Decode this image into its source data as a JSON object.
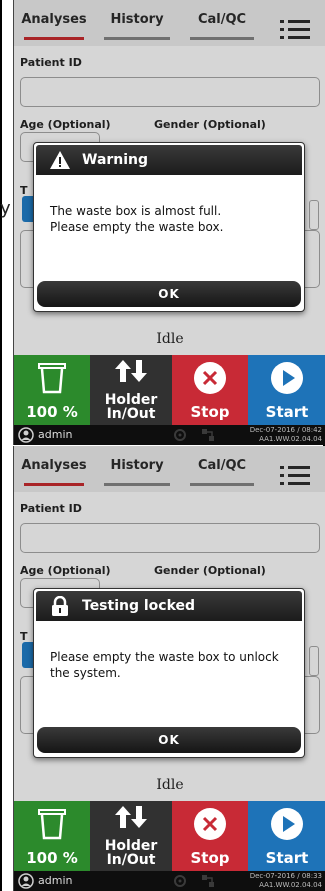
{
  "side_glyph": "y",
  "screens": [
    {
      "tabs": [
        {
          "label": "Analyses",
          "active": true
        },
        {
          "label": "History",
          "active": false
        },
        {
          "label": "Cal/QC",
          "active": false
        }
      ],
      "menu_icon": "hamburger-menu-icon",
      "form": {
        "patient_id_label": "Patient ID",
        "age_label": "Age (Optional)",
        "gender_label": "Gender (Optional)",
        "partial_label": "T"
      },
      "dialog": {
        "icon": "warning-triangle-icon",
        "title": "Warning",
        "lines": [
          "The waste box is almost full.",
          "Please empty the waste box."
        ],
        "ok_label": "OK"
      },
      "status_text": "Idle",
      "actions": {
        "waste_percent": "100 %",
        "holder_line1": "Holder",
        "holder_line2": "In/Out",
        "stop": "Stop",
        "start": "Start"
      },
      "statusbar": {
        "user": "admin",
        "datetime": "Dec-07-2016 / 08:42",
        "version": "AA1.WW.02.04.04"
      }
    },
    {
      "tabs": [
        {
          "label": "Analyses",
          "active": true
        },
        {
          "label": "History",
          "active": false
        },
        {
          "label": "Cal/QC",
          "active": false
        }
      ],
      "menu_icon": "hamburger-menu-icon",
      "form": {
        "patient_id_label": "Patient ID",
        "age_label": "Age (Optional)",
        "gender_label": "Gender (Optional)",
        "partial_label": "T"
      },
      "dialog": {
        "icon": "lock-icon",
        "title": "Testing locked",
        "lines": [
          "Please empty the waste box to unlock",
          "the system."
        ],
        "ok_label": "OK"
      },
      "status_text": "Idle",
      "actions": {
        "waste_percent": "100 %",
        "holder_line1": "Holder",
        "holder_line2": "In/Out",
        "stop": "Stop",
        "start": "Start"
      },
      "statusbar": {
        "user": "admin",
        "datetime": "Dec-07-2016 / 08:33",
        "version": "AA1.WW.02.04.04"
      }
    }
  ],
  "colors": {
    "active_tab_underline": "#b8282b",
    "waste_green": "#2c8a2c",
    "holder_dark": "#313131",
    "stop_red": "#c82a36",
    "start_blue": "#1e73b8"
  }
}
